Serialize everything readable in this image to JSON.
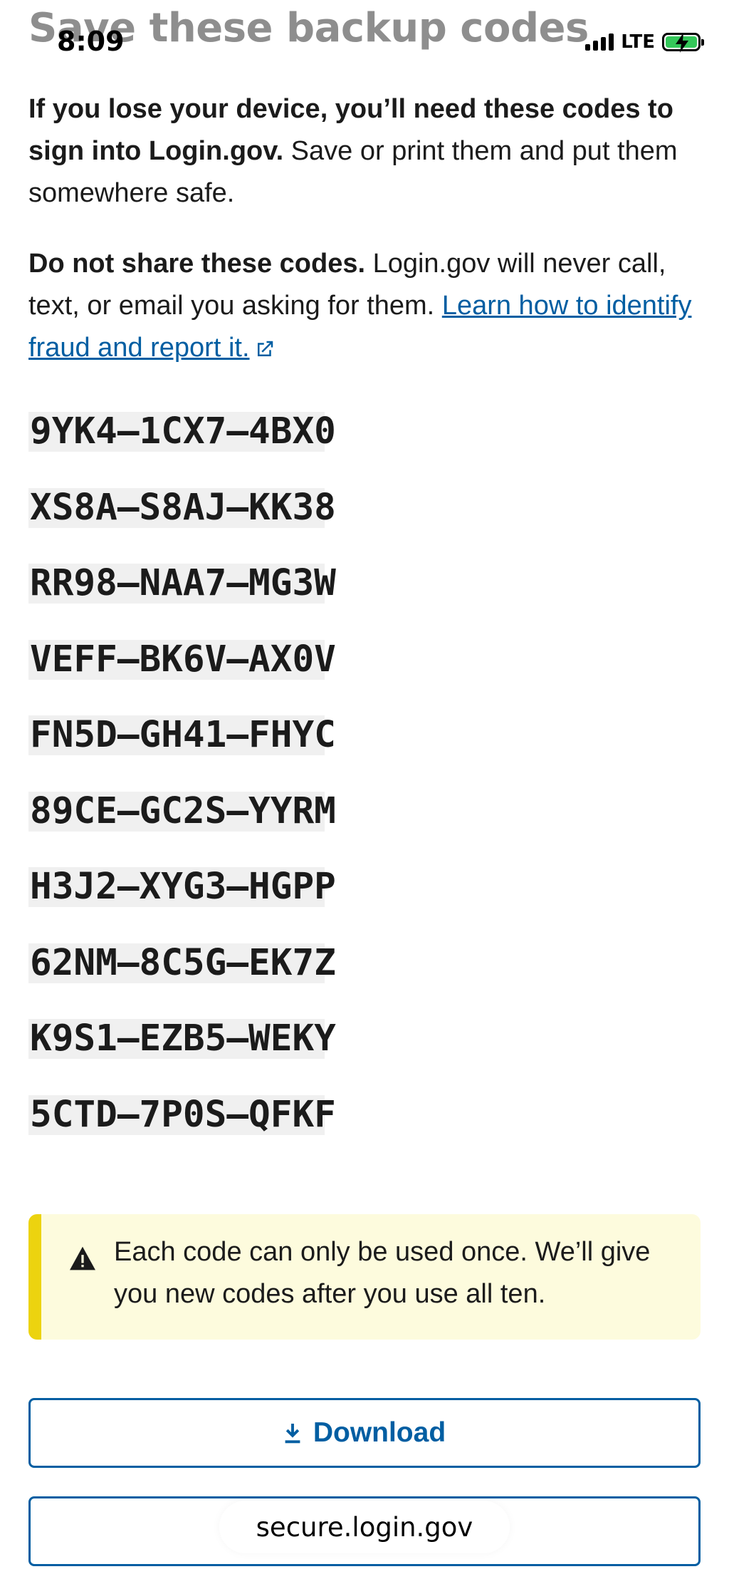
{
  "header": {
    "title": "Save these backup codes"
  },
  "status_bar": {
    "time": "8:09",
    "network": "LTE"
  },
  "intro": {
    "bold": "If you lose your device, you’ll need these codes to sign into Login.gov.",
    "rest": " Save or print them and put them somewhere safe."
  },
  "warning_text": {
    "bold": "Do not share these codes.",
    "rest": " Login.gov will never call, text, or email you asking for them. ",
    "link": "Learn how to identify fraud and report it."
  },
  "codes": [
    "9YK4–1CX7–4BX0",
    "XS8A–S8AJ–KK38",
    "RR98–NAA7–MG3W",
    "VEFF–BK6V–AX0V",
    "FN5D–GH41–FHYC",
    "89CE–GC2S–YYRM",
    "H3J2–XYG3–HGPP",
    "62NM–8C5G–EK7Z",
    "K9S1–EZB5–WEKY",
    "5CTD–7P0S–QFKF"
  ],
  "alert": {
    "text": "Each code can only be used once. We’ll give you new codes after you use all ten."
  },
  "buttons": {
    "download": "Download",
    "second": ""
  },
  "browser": {
    "url": "secure.login.gov"
  },
  "colors": {
    "link": "#005ea2",
    "alert_bg": "#fdfbdd",
    "alert_bar": "#ecd30f",
    "code_bg": "#f0f0f0"
  }
}
